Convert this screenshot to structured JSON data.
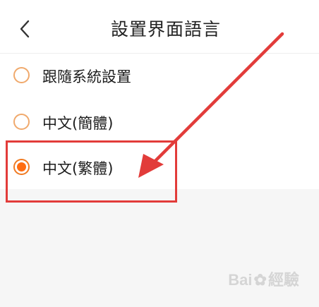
{
  "header": {
    "title": "設置界面語言",
    "back_icon": "chevron-left-icon"
  },
  "options": [
    {
      "label": "跟隨系統設置",
      "selected": false
    },
    {
      "label": "中文(簡體)",
      "selected": false
    },
    {
      "label": "中文(繁體)",
      "selected": true
    }
  ],
  "colors": {
    "accent": "#ff6d12",
    "radio_border": "#f0a96c",
    "annotation": "#e23c3a"
  },
  "watermark": {
    "text_left": "Bai",
    "text_right": "經驗"
  }
}
